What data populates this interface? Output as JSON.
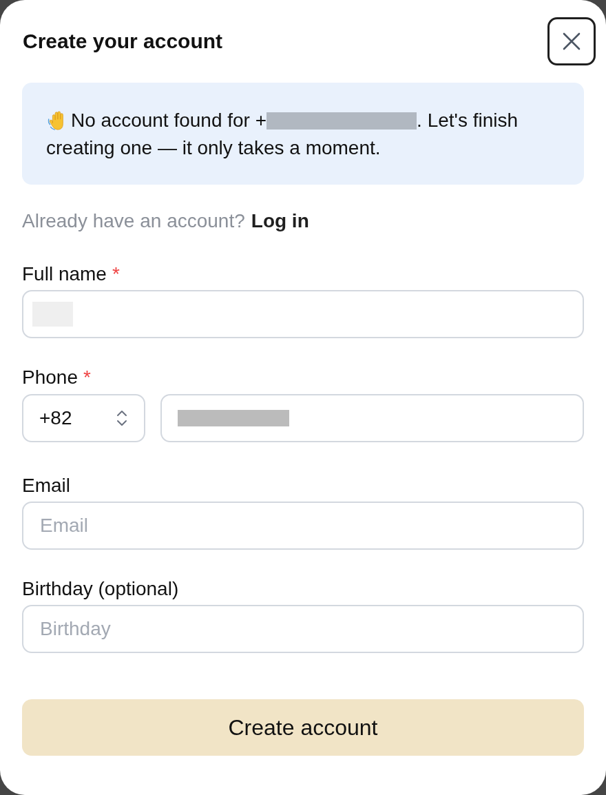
{
  "dialog": {
    "title": "Create your account"
  },
  "notice": {
    "line_1_before": "No account found for +",
    "number_redacted": true,
    "line_1_after": ". Let's finish",
    "line_2": "creating one — it only takes a moment."
  },
  "login_prompt": {
    "text": "Already have an account?",
    "link": "Log in"
  },
  "fields": [
    {
      "kind": "text",
      "label": "Full name",
      "required_mark": "*",
      "value_redacted": true
    },
    {
      "kind": "phone",
      "label": "Phone",
      "required_mark": "*",
      "country_code": "+82",
      "value_redacted": true
    },
    {
      "kind": "text",
      "label": "Email",
      "placeholder": "Email",
      "value_redacted": false
    },
    {
      "kind": "text",
      "label": "Birthday (optional)",
      "placeholder": "Birthday",
      "value_redacted": false
    }
  ],
  "submit_button": {
    "label": "Create account"
  }
}
